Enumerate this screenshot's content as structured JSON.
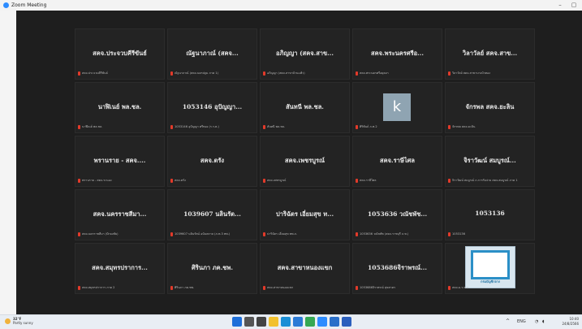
{
  "window": {
    "title": "Zoom Meeting",
    "minimize_label": "–",
    "restore_label": "▢"
  },
  "tiles": [
    {
      "name": "สคจ.ประจวบคีรีขันธ์",
      "footer": "สคจ.ประจวบคีรีขันธ์"
    },
    {
      "name": "ณัฐนาภาณ์ (สคจ...",
      "footer": "ณัฐนาภาณ์ (สคจ.นครปฐม ภาค 1)"
    },
    {
      "name": "อภิญญา (สคจ.สาข...",
      "footer": "อภิญญา (สคจ.สาขาบ้านแพ้ว)"
    },
    {
      "name": "สคจ.พระนครศรีอ...",
      "footer": "สคจ.พระนครศรีอยุธยา"
    },
    {
      "name": "วิลาวัลย์ สคจ.สาข...",
      "footer": "วิลาวัลย์ สคจ.สาขาบางบัวทอง"
    },
    {
      "name": "นาฬิเนย์ พล.ชล.",
      "footer": "นาฬิเนย์ พล.ชล."
    },
    {
      "name": "1053146 อุปัญญา...",
      "footer": "1053146 อุปัญญา ศรีทอง (ร.ร.ต.)"
    },
    {
      "name": "สันทนี พล.ชล.",
      "footer": "สันทนี พล.ชล."
    },
    {
      "name": "k",
      "footer": "ศิริพันธ์ ภ.ท.2",
      "avatar": "k"
    },
    {
      "name": "จักรพล สคจ.ยะลิน",
      "footer": "จักรพล สคจ.ยะลิน"
    },
    {
      "name": "พรานราย - สคจ....",
      "footer": "พรานราย - สคจ.ระนอง"
    },
    {
      "name": "สคจ.ตรัง",
      "footer": "สคจ.ตรัง"
    },
    {
      "name": "สคจ.เพชรบูรณ์",
      "footer": "สคจ.เพชรบูรณ์"
    },
    {
      "name": "สคจ.ราษีไศล",
      "footer": "สคจ.ราษีไศล"
    },
    {
      "name": "จิราวัฒน์ สมบูรณ์...",
      "footer": "จิราวัฒน์ สมบูรณ์ ภ.การรับจ่าย สคจ.สมบูรณ์ ภาค 1"
    },
    {
      "name": "สคจ.นครราชสีมา...",
      "footer": "สคจ.นครราชสีมา (ปักธงชัย)"
    },
    {
      "name": "1039607 นลินรัต...",
      "footer": "1039607 นลินรัตน์ อนันตกาล (ภ.ท.3 ทพ.)"
    },
    {
      "name": "ปาริฉัตร เอี่ยมสุข ท...",
      "footer": "ปาริฉัตร เอี่ยมสุข ทพ.ภ."
    },
    {
      "name": "1053636 วณัชพัช...",
      "footer": "1053636 วณัชพัช (สคจ.ราชบุรี ภ.ท.)"
    },
    {
      "name": "1053136",
      "footer": "1053136"
    },
    {
      "name": "สคจ.สมุทรปราการ...",
      "footer": "สคจ.สมุทรปราการ ภาค 2"
    },
    {
      "name": "ศิรินภา ภค.ชพ.",
      "footer": "ศิรินภา ภค.ชพ."
    },
    {
      "name": "สคจ.สาขาหนองแขก",
      "footer": "สคจ.สาขาหนองแขก"
    },
    {
      "name": "1053686จิราพรณ์...",
      "footer": "1053686จิราพรณ์ สุขสาคร"
    },
    {
      "name": "",
      "footer": "สคจ.ม.ร.พ.ร",
      "logo": "กรมบัญชีกลาง"
    }
  ],
  "taskbar": {
    "temperature": "32°F",
    "condition": "Partly sunny",
    "time": "10:40",
    "date": "24/8/2566",
    "language": "ENG",
    "icons": [
      "windows-start-icon",
      "search-icon",
      "task-view-icon",
      "file-explorer-icon",
      "edge-icon",
      "store-icon",
      "chrome-icon",
      "zoom-icon",
      "outlook-icon",
      "word-icon"
    ],
    "icon_colors": [
      "#1e6fd9",
      "#555555",
      "#444444",
      "#f2c12e",
      "#1b8fd6",
      "#2b7bd6",
      "#35a853",
      "#2d8cff",
      "#2a6fc9",
      "#2b5fbd"
    ]
  },
  "colors": {
    "meeting_bg": "#1e1e1e",
    "tile_bg": "#232323",
    "mic_muted": "#e23a2a",
    "zoom_blue": "#2d8cff"
  }
}
